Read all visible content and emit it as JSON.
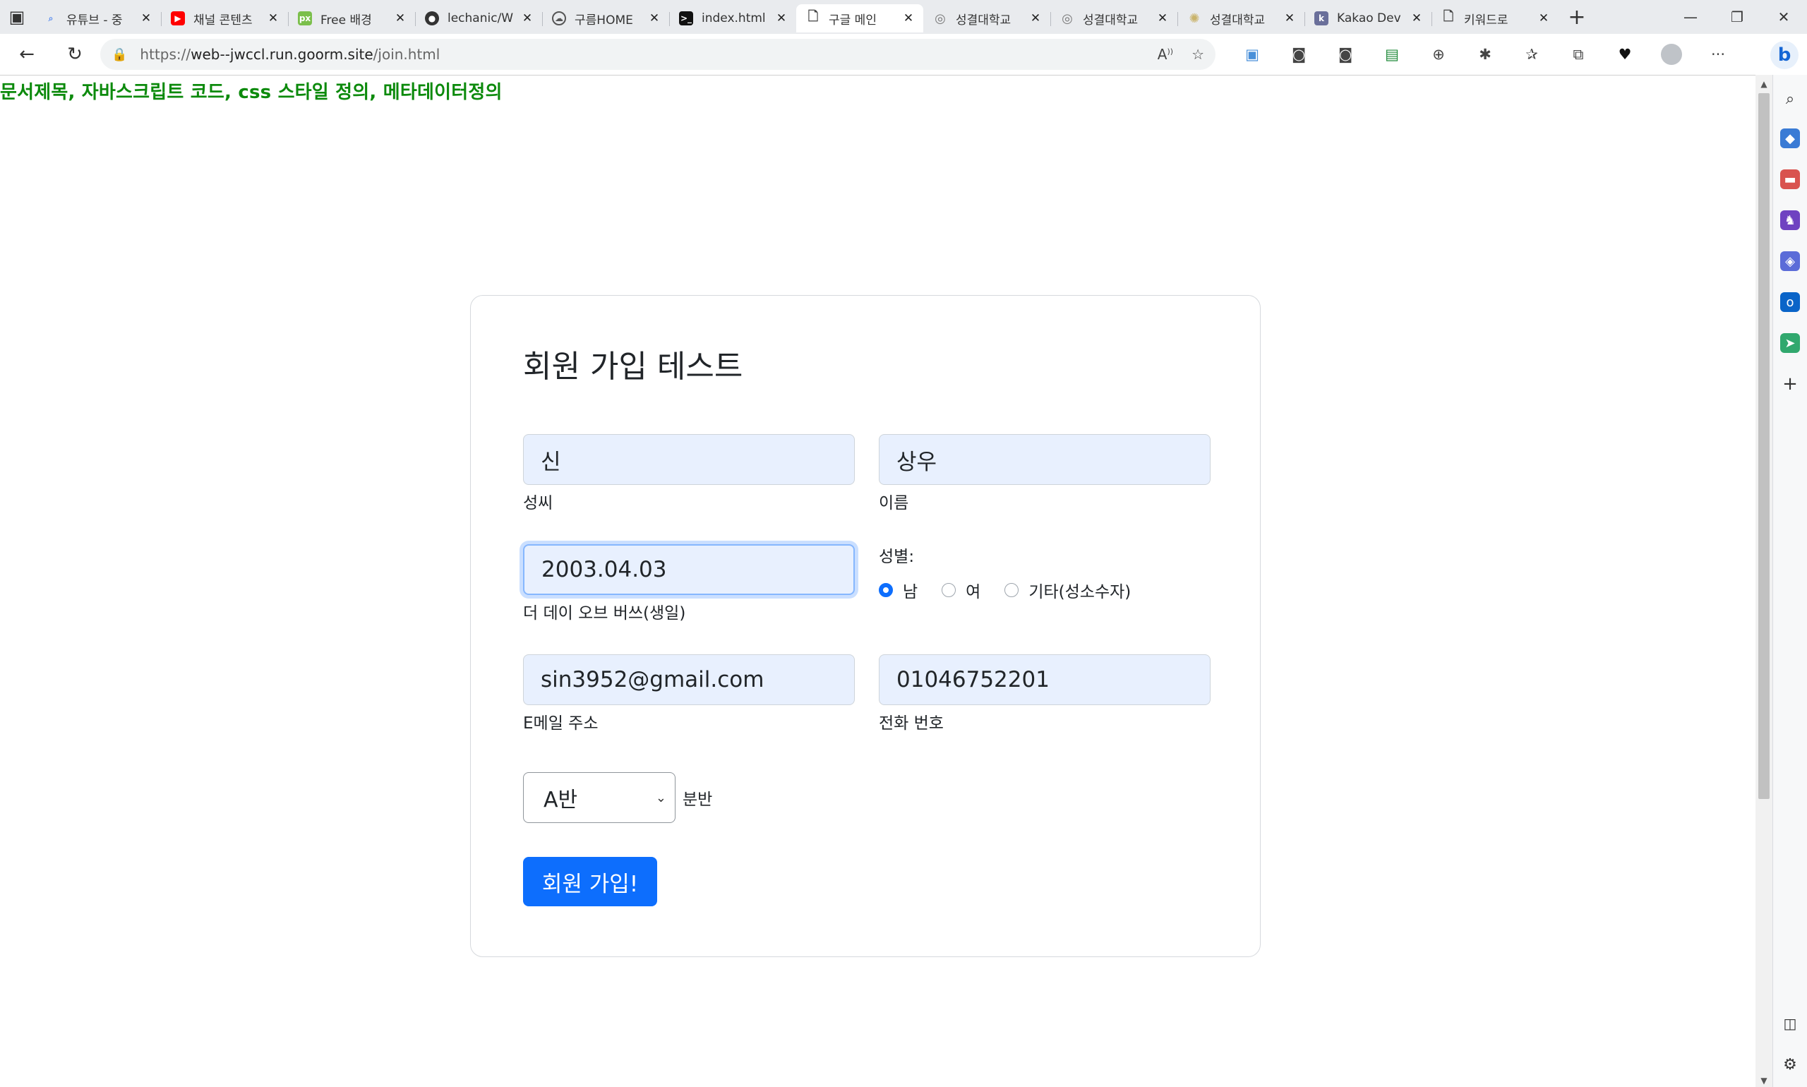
{
  "browser": {
    "tabs": [
      {
        "title": "유튜브 - 중",
        "favicon": "search-icon",
        "color": "#5b8def"
      },
      {
        "title": "채널 콘텐츠",
        "favicon": "youtube-icon",
        "color": "#ff0000"
      },
      {
        "title": "Free 배경",
        "favicon": "px-icon",
        "color": "#7bbf4b"
      },
      {
        "title": "lechanic/W",
        "favicon": "github-icon",
        "color": "#333333"
      },
      {
        "title": "구름HOME",
        "favicon": "cloud-icon",
        "color": "#555555"
      },
      {
        "title": "index.html",
        "favicon": "terminal-icon",
        "color": "#111111"
      },
      {
        "title": "구글 메인",
        "favicon": "page-icon",
        "color": "#555555",
        "active": true
      },
      {
        "title": "성결대학교",
        "favicon": "globe-icon",
        "color": "#7a7a7a"
      },
      {
        "title": "성결대학교",
        "favicon": "globe-icon",
        "color": "#7a7a7a"
      },
      {
        "title": "성결대학교",
        "favicon": "sun-icon",
        "color": "#c9b36b"
      },
      {
        "title": "Kakao Dev",
        "favicon": "kakao-icon",
        "color": "#6a6f9a"
      },
      {
        "title": "키워드로",
        "favicon": "page-icon",
        "color": "#555555"
      }
    ],
    "url_prefix": "https://",
    "url_host": "web--jwccl.run.goorm.site",
    "url_path": "/join.html"
  },
  "page": {
    "heading": "문서제목, 자바스크립트 코드, css 스타일 정의, 메타데이터정의"
  },
  "form": {
    "title": "회원 가입 테스트",
    "last_name": {
      "value": "신",
      "label": "성씨"
    },
    "first_name": {
      "value": "상우",
      "label": "이름"
    },
    "birthday": {
      "value": "2003.04.03",
      "label": "더 데이 오브 버쓰(생일)"
    },
    "gender": {
      "label": "성별:",
      "options": [
        "남",
        "여",
        "기타(성소수자)"
      ],
      "selected": "남"
    },
    "email": {
      "value": "sin3952@gmail.com",
      "label": "E메일 주소"
    },
    "phone": {
      "value": "01046752201",
      "label": "전화 번호"
    },
    "class_select": {
      "value": "A반",
      "label": "분반"
    },
    "submit_label": "회원 가입!"
  },
  "colors": {
    "heading": "#0c8a0c",
    "input_bg": "#e8f0fe",
    "primary": "#0d6efd"
  }
}
